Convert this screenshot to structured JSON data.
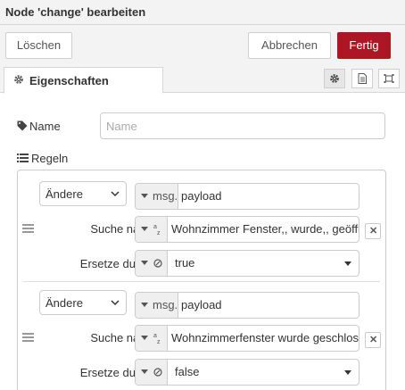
{
  "header": {
    "title": "Node 'change' bearbeiten"
  },
  "toolbar": {
    "delete_label": "Löschen",
    "cancel_label": "Abbrechen",
    "done_label": "Fertig"
  },
  "tabs": {
    "properties_label": "Eigenschaften"
  },
  "form": {
    "name_label": "Name",
    "name_placeholder": "Name",
    "name_value": "",
    "rules_label": "Regeln"
  },
  "rules": [
    {
      "action": "Ändere",
      "property_type": "msg.",
      "property_value": "payload",
      "search_label": "Suche nach",
      "search_type": "az",
      "search_value": "Wohnzimmer Fenster,, wurde,, geöffn",
      "replace_label": "Ersetze durch",
      "replace_value": "true"
    },
    {
      "action": "Ändere",
      "property_type": "msg.",
      "property_value": "payload",
      "search_label": "Suche nach",
      "search_type": "az",
      "search_value": "Wohnzimmerfenster wurde geschloss",
      "replace_label": "Ersetze durch",
      "replace_value": "false"
    }
  ]
}
